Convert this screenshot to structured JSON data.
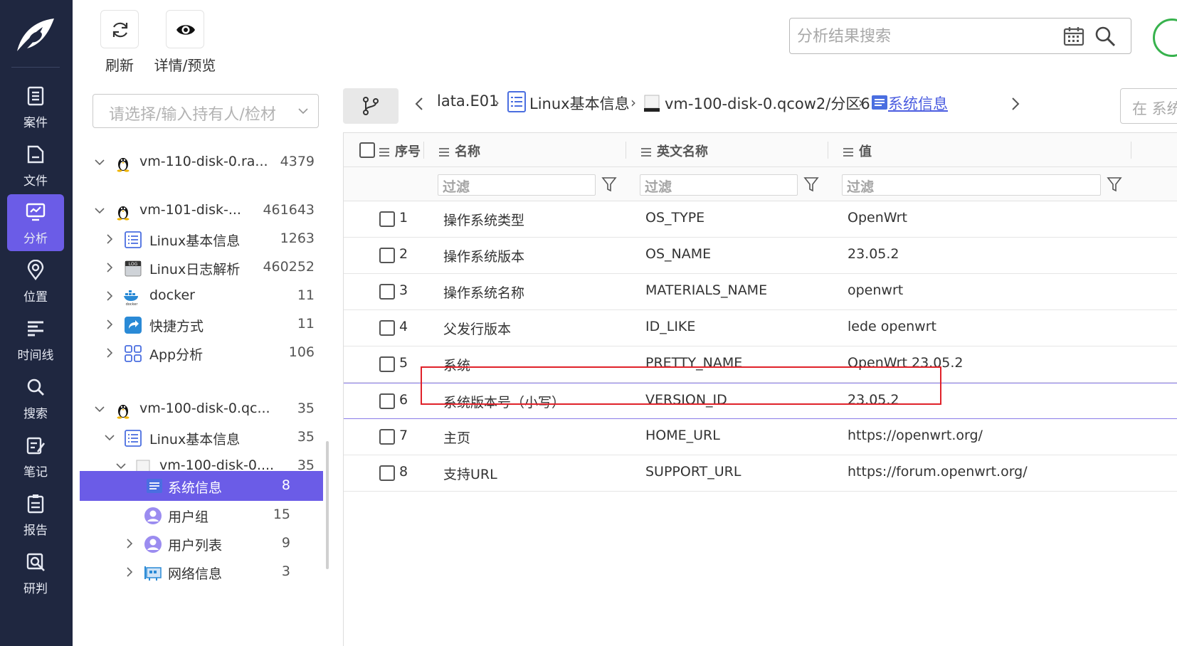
{
  "nav": {
    "items": [
      {
        "label": "案件",
        "icon": "case-icon",
        "active": false
      },
      {
        "label": "文件",
        "icon": "file-icon",
        "active": false
      },
      {
        "label": "分析",
        "icon": "analysis-icon",
        "active": true
      },
      {
        "label": "位置",
        "icon": "location-icon",
        "active": false
      },
      {
        "label": "时间线",
        "icon": "timeline-icon",
        "active": false
      },
      {
        "label": "搜索",
        "icon": "search-icon",
        "active": false
      },
      {
        "label": "笔记",
        "icon": "note-icon",
        "active": false
      },
      {
        "label": "报告",
        "icon": "report-icon",
        "active": false
      },
      {
        "label": "研判",
        "icon": "judge-icon",
        "active": false
      }
    ]
  },
  "toolbar": {
    "refresh_label": "刷新",
    "preview_label": "详情/预览",
    "search_placeholder": "分析结果搜索"
  },
  "tree": {
    "owner_placeholder": "请选择/输入持有人/检材",
    "rows": [
      {
        "label": "vm-110-disk-0.ra...",
        "count": "4379",
        "icon": "linux-penguin-icon"
      },
      {
        "label": "vm-101-disk-...",
        "count": "461643",
        "icon": "linux-penguin-icon"
      },
      {
        "label": "Linux基本信息",
        "count": "1263",
        "icon": "list-icon"
      },
      {
        "label": "Linux日志解析",
        "count": "460252",
        "icon": "log-icon"
      },
      {
        "label": "docker",
        "count": "11",
        "icon": "docker-icon"
      },
      {
        "label": "快捷方式",
        "count": "11",
        "icon": "shortcut-icon"
      },
      {
        "label": "App分析",
        "count": "106",
        "icon": "app-grid-icon"
      },
      {
        "label": "vm-100-disk-0.qc...",
        "count": "35",
        "icon": "linux-penguin-icon"
      },
      {
        "label": "Linux基本信息",
        "count": "35",
        "icon": "list-icon"
      },
      {
        "label": "vm-100-disk-0....",
        "count": "35",
        "icon": "disk-icon"
      },
      {
        "label": "系统信息",
        "count": "8",
        "icon": "system-info-icon"
      },
      {
        "label": "用户组",
        "count": "15",
        "icon": "user-icon"
      },
      {
        "label": "用户列表",
        "count": "9",
        "icon": "user-icon"
      },
      {
        "label": "网络信息",
        "count": "3",
        "icon": "network-icon"
      }
    ]
  },
  "breadcrumb": {
    "items": [
      "lata.E01",
      "Linux基本信息",
      "vm-100-disk-0.qcow2/分区6",
      "系统信息"
    ],
    "right_search_placeholder": "在 系统"
  },
  "table": {
    "headers": {
      "index": "序号",
      "name": "名称",
      "en_name": "英文名称",
      "value": "值"
    },
    "filter_placeholder": "过滤",
    "rows": [
      {
        "index": "1",
        "name": "操作系统类型",
        "en_name": "OS_TYPE",
        "value": "OpenWrt"
      },
      {
        "index": "2",
        "name": "操作系统版本",
        "en_name": "OS_NAME",
        "value": "23.05.2"
      },
      {
        "index": "3",
        "name": "操作系统名称",
        "en_name": "MATERIALS_NAME",
        "value": "openwrt"
      },
      {
        "index": "4",
        "name": "父发行版本",
        "en_name": "ID_LIKE",
        "value": "lede openwrt"
      },
      {
        "index": "5",
        "name": "系统",
        "en_name": "PRETTY_NAME",
        "value": "OpenWrt 23.05.2"
      },
      {
        "index": "6",
        "name": "系统版本号（小写）",
        "en_name": "VERSION_ID",
        "value": "23.05.2"
      },
      {
        "index": "7",
        "name": "主页",
        "en_name": "HOME_URL",
        "value": "https://openwrt.org/"
      },
      {
        "index": "8",
        "name": "支持URL",
        "en_name": "SUPPORT_URL",
        "value": "https://forum.openwrt.org/"
      }
    ]
  },
  "colors": {
    "nav_bg": "#1f2740",
    "accent": "#6b5ce7",
    "highlight": "#e0222a",
    "link": "#4a5ce0"
  }
}
